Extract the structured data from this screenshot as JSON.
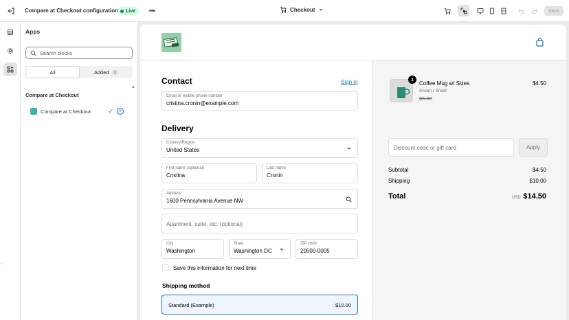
{
  "topbar": {
    "title": "Compare at Checkout configuration",
    "status": "Live",
    "page_selector": "Checkout",
    "save_label": "Save"
  },
  "panel": {
    "title": "Apps",
    "search_placeholder": "Search blocks",
    "tabs": [
      {
        "label": "All",
        "active": true
      },
      {
        "label": "Added",
        "count": "1",
        "active": false
      }
    ],
    "section_title": "Compare at Checkout",
    "block_label": "Compare at Checkout"
  },
  "checkout": {
    "contact": {
      "heading": "Contact",
      "sign_in": "Sign in",
      "email_label": "Email or mobile phone number",
      "email_value": "cristina.cronin@example.com"
    },
    "delivery": {
      "heading": "Delivery",
      "country_label": "Country/Region",
      "country_value": "United States",
      "first_name_label": "First name (optional)",
      "first_name_value": "Cristina",
      "last_name_label": "Last name",
      "last_name_value": "Cronin",
      "address_label": "Address",
      "address_value": "1600 Pennsylvania Avenue NW",
      "apartment_placeholder": "Apartment, suite, etc. (optional)",
      "city_label": "City",
      "city_value": "Washington",
      "state_label": "State",
      "state_value": "Washington DC",
      "zip_label": "ZIP code",
      "zip_value": "20500-0005",
      "save_info_label": "Save this information for next time"
    },
    "shipping": {
      "heading": "Shipping method",
      "option_name": "Standard (Example)",
      "option_price": "$10.00"
    }
  },
  "summary": {
    "item": {
      "quantity": "1",
      "name": "Coffee Mug w/ Sizes",
      "variant": "Green / Small",
      "compare_price": "$5.00",
      "price": "$4.50"
    },
    "discount_placeholder": "Discount code or gift card",
    "apply_label": "Apply",
    "subtotal_label": "Subtotal",
    "subtotal_value": "$4.50",
    "shipping_label": "Shipping",
    "shipping_value": "$10.00",
    "total_label": "Total",
    "currency": "USD",
    "total_value": "$14.50"
  },
  "colors": {
    "accent_link": "#1773b0",
    "live_badge_bg": "#cdfee1",
    "live_badge_text": "#0c5132"
  }
}
